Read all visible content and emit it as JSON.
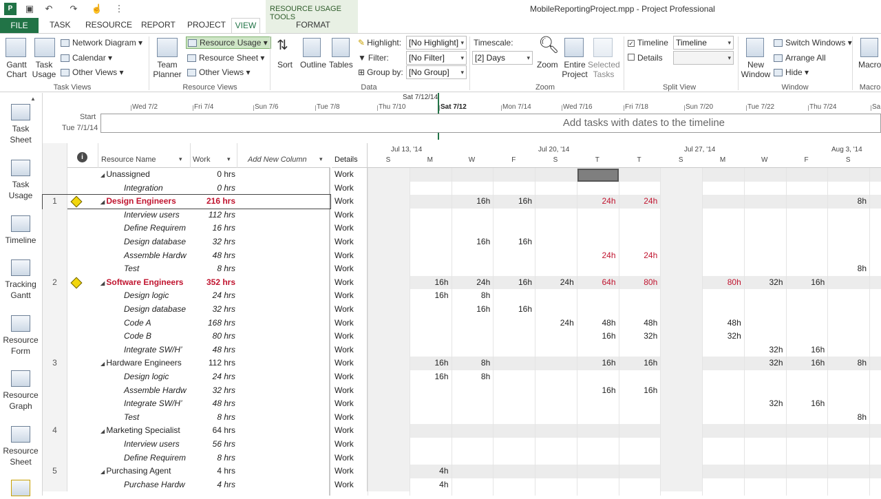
{
  "window": {
    "title": "MobileReportingProject.mpp - Project Professional"
  },
  "contextual_tab": "RESOURCE USAGE TOOLS",
  "tabs": [
    "FILE",
    "TASK",
    "RESOURCE",
    "REPORT",
    "PROJECT",
    "VIEW",
    "FORMAT"
  ],
  "ribbon": {
    "task_views": {
      "label": "Task Views",
      "gantt": "Gantt Chart",
      "task_usage": "Task Usage",
      "network": "Network Diagram",
      "calendar": "Calendar",
      "other": "Other Views"
    },
    "resource_views": {
      "label": "Resource Views",
      "team_planner": "Team Planner",
      "resource_usage": "Resource Usage",
      "resource_sheet": "Resource Sheet",
      "other": "Other Views"
    },
    "data": {
      "label": "Data",
      "sort": "Sort",
      "outline": "Outline",
      "tables": "Tables",
      "highlight_label": "Highlight:",
      "highlight_value": "[No Highlight]",
      "filter_label": "Filter:",
      "filter_value": "[No Filter]",
      "group_label": "Group by:",
      "group_value": "[No Group]"
    },
    "zoom": {
      "label": "Zoom",
      "timescale_label": "Timescale:",
      "timescale_value": "[2] Days",
      "zoom": "Zoom",
      "entire": "Entire Project",
      "selected": "Selected Tasks"
    },
    "split_view": {
      "label": "Split View",
      "timeline": "Timeline",
      "timeline_value": "Timeline",
      "details": "Details"
    },
    "window": {
      "label": "Window",
      "new_window": "New Window",
      "switch": "Switch Windows",
      "arrange": "Arrange All",
      "hide": "Hide"
    },
    "macros": {
      "label": "Macro",
      "macros": "Macro"
    }
  },
  "viewbar": [
    "Task Sheet",
    "Task Usage",
    "Timeline",
    "Tracking Gantt",
    "Resource Form",
    "Resource Graph",
    "Resource Sheet"
  ],
  "timeline": {
    "start_label": "Start",
    "start_date": "Tue 7/1/14",
    "today_label": "Sat 7/12/14",
    "placeholder": "Add tasks with dates to the timeline",
    "dates": [
      "Wed 7/2",
      "Fri 7/4",
      "Sun 7/6",
      "Tue 7/8",
      "Thu 7/10",
      "Sat 7/12",
      "Mon 7/14",
      "Wed 7/16",
      "Fri 7/18",
      "Sun 7/20",
      "Tue 7/22",
      "Thu 7/24",
      "Sa"
    ]
  },
  "grid": {
    "headers": {
      "info": "i",
      "name": "Resource Name",
      "work": "Work",
      "add": "Add New Column"
    },
    "rows": [
      {
        "id": "",
        "name": "Unassigned",
        "work": "0 hrs",
        "type": "res"
      },
      {
        "id": "",
        "name": "Integration",
        "work": "0 hrs",
        "type": "asg"
      },
      {
        "id": "1",
        "name": "Design Engineers",
        "work": "216 hrs",
        "type": "over"
      },
      {
        "id": "",
        "name": "Interview users",
        "work": "112 hrs",
        "type": "asg"
      },
      {
        "id": "",
        "name": "Define Requirem",
        "work": "16 hrs",
        "type": "asg"
      },
      {
        "id": "",
        "name": "Design database",
        "work": "32 hrs",
        "type": "asg"
      },
      {
        "id": "",
        "name": "Assemble Hardw",
        "work": "48 hrs",
        "type": "asg"
      },
      {
        "id": "",
        "name": "Test",
        "work": "8 hrs",
        "type": "asg"
      },
      {
        "id": "2",
        "name": "Software Engineers",
        "work": "352 hrs",
        "type": "over"
      },
      {
        "id": "",
        "name": "Design logic",
        "work": "24 hrs",
        "type": "asg"
      },
      {
        "id": "",
        "name": "Design database",
        "work": "32 hrs",
        "type": "asg"
      },
      {
        "id": "",
        "name": "Code A",
        "work": "168 hrs",
        "type": "asg"
      },
      {
        "id": "",
        "name": "Code B",
        "work": "80 hrs",
        "type": "asg"
      },
      {
        "id": "",
        "name": "Integrate SW/H’",
        "work": "48 hrs",
        "type": "asg"
      },
      {
        "id": "3",
        "name": "Hardware Engineers",
        "work": "112 hrs",
        "type": "res"
      },
      {
        "id": "",
        "name": "Design logic",
        "work": "24 hrs",
        "type": "asg"
      },
      {
        "id": "",
        "name": "Assemble Hardw",
        "work": "32 hrs",
        "type": "asg"
      },
      {
        "id": "",
        "name": "Integrate SW/H’",
        "work": "48 hrs",
        "type": "asg"
      },
      {
        "id": "",
        "name": "Test",
        "work": "8 hrs",
        "type": "asg"
      },
      {
        "id": "4",
        "name": "Marketing Specialist",
        "work": "64 hrs",
        "type": "res"
      },
      {
        "id": "",
        "name": "Interview users",
        "work": "56 hrs",
        "type": "asg"
      },
      {
        "id": "",
        "name": "Define Requirem",
        "work": "8 hrs",
        "type": "asg"
      },
      {
        "id": "5",
        "name": "Purchasing Agent",
        "work": "4 hrs",
        "type": "res"
      },
      {
        "id": "",
        "name": "Purchase Hardw",
        "work": "4 hrs",
        "type": "asg"
      }
    ]
  },
  "usage": {
    "details_header": "Details",
    "detail_label": "Work",
    "weeks": [
      "Jul 13, '14",
      "Jul 20, '14",
      "Jul 27, '14",
      "Aug 3, '14"
    ],
    "days": [
      "S",
      "M",
      "W",
      "F",
      "S",
      "T",
      "T",
      "S",
      "M",
      "W",
      "F",
      "S"
    ],
    "values": [
      [
        "",
        "",
        "",
        "",
        "",
        "",
        "",
        "",
        "",
        "",
        "",
        ""
      ],
      [
        "",
        "",
        "",
        "",
        "",
        "",
        "",
        "",
        "",
        "",
        "",
        ""
      ],
      [
        "",
        "",
        "16h",
        "16h",
        "",
        "24h",
        "24h",
        "",
        "",
        "",
        "",
        "8h"
      ],
      [
        "",
        "",
        "",
        "",
        "",
        "",
        "",
        "",
        "",
        "",
        "",
        ""
      ],
      [
        "",
        "",
        "",
        "",
        "",
        "",
        "",
        "",
        "",
        "",
        "",
        ""
      ],
      [
        "",
        "",
        "16h",
        "16h",
        "",
        "",
        "",
        "",
        "",
        "",
        "",
        ""
      ],
      [
        "",
        "",
        "",
        "",
        "",
        "24h",
        "24h",
        "",
        "",
        "",
        "",
        ""
      ],
      [
        "",
        "",
        "",
        "",
        "",
        "",
        "",
        "",
        "",
        "",
        "",
        "8h"
      ],
      [
        "",
        "16h",
        "24h",
        "16h",
        "24h",
        "64h",
        "80h",
        "",
        "80h",
        "32h",
        "16h",
        ""
      ],
      [
        "",
        "16h",
        "8h",
        "",
        "",
        "",
        "",
        "",
        "",
        "",
        "",
        ""
      ],
      [
        "",
        "",
        "16h",
        "16h",
        "",
        "",
        "",
        "",
        "",
        "",
        "",
        ""
      ],
      [
        "",
        "",
        "",
        "",
        "24h",
        "48h",
        "48h",
        "",
        "48h",
        "",
        "",
        ""
      ],
      [
        "",
        "",
        "",
        "",
        "",
        "16h",
        "32h",
        "",
        "32h",
        "",
        "",
        ""
      ],
      [
        "",
        "",
        "",
        "",
        "",
        "",
        "",
        "",
        "",
        "32h",
        "16h",
        ""
      ],
      [
        "",
        "16h",
        "8h",
        "",
        "",
        "16h",
        "16h",
        "",
        "",
        "32h",
        "16h",
        "8h"
      ],
      [
        "",
        "16h",
        "8h",
        "",
        "",
        "",
        "",
        "",
        "",
        "",
        "",
        ""
      ],
      [
        "",
        "",
        "",
        "",
        "",
        "16h",
        "16h",
        "",
        "",
        "",
        "",
        ""
      ],
      [
        "",
        "",
        "",
        "",
        "",
        "",
        "",
        "",
        "",
        "32h",
        "16h",
        ""
      ],
      [
        "",
        "",
        "",
        "",
        "",
        "",
        "",
        "",
        "",
        "",
        "",
        "8h"
      ],
      [
        "",
        "",
        "",
        "",
        "",
        "",
        "",
        "",
        "",
        "",
        "",
        ""
      ],
      [
        "",
        "",
        "",
        "",
        "",
        "",
        "",
        "",
        "",
        "",
        "",
        ""
      ],
      [
        "",
        "",
        "",
        "",
        "",
        "",
        "",
        "",
        "",
        "",
        "",
        ""
      ],
      [
        "",
        "4h",
        "",
        "",
        "",
        "",
        "",
        "",
        "",
        "",
        "",
        ""
      ],
      [
        "",
        "4h",
        "",
        "",
        "",
        "",
        "",
        "",
        "",
        "",
        "",
        ""
      ]
    ],
    "overallocated": [
      [
        2,
        5
      ],
      [
        2,
        6
      ],
      [
        6,
        5
      ],
      [
        6,
        6
      ],
      [
        8,
        5
      ],
      [
        8,
        6
      ],
      [
        8,
        8
      ]
    ]
  },
  "colors": {
    "accent": "#217346",
    "overallocated": "#c0142f",
    "shade": "#ececec"
  }
}
